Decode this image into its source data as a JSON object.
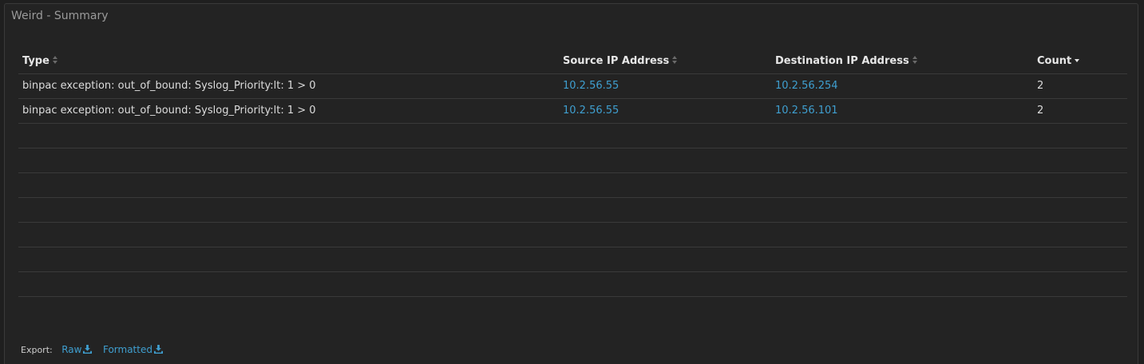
{
  "panel": {
    "title": "Weird - Summary"
  },
  "table": {
    "columns": [
      {
        "label": "Type",
        "sort": "none"
      },
      {
        "label": "Source IP Address",
        "sort": "none"
      },
      {
        "label": "Destination IP Address",
        "sort": "none"
      },
      {
        "label": "Count",
        "sort": "desc"
      }
    ],
    "rows": [
      {
        "type": "binpac exception: out_of_bound: Syslog_Priority:lt: 1 > 0",
        "src": "10.2.56.55",
        "dst": "10.2.56.254",
        "count": "2"
      },
      {
        "type": "binpac exception: out_of_bound: Syslog_Priority:lt: 1 > 0",
        "src": "10.2.56.55",
        "dst": "10.2.56.101",
        "count": "2"
      }
    ]
  },
  "export": {
    "label": "Export:",
    "raw": "Raw",
    "formatted": "Formatted",
    "icon": "download-icon"
  },
  "colors": {
    "link": "#3f9fd0",
    "panel_bg": "#232323",
    "border": "#3a3a3a"
  }
}
